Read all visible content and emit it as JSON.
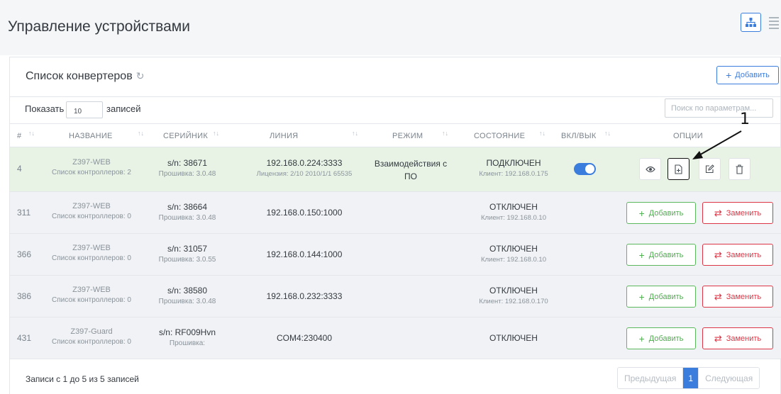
{
  "page": {
    "title": "Управление устройствами"
  },
  "card": {
    "title": "Список конвертеров",
    "add_button": "Добавить",
    "show_prefix": "Показать",
    "show_value": "10",
    "show_suffix": "записей",
    "search_placeholder": "Поиск по параметрам..."
  },
  "columns": [
    "#",
    "НАЗВАНИЕ",
    "СЕРИЙНИК",
    "ЛИНИЯ",
    "РЕЖИМ",
    "СОСТОЯНИЕ",
    "ВКЛ/ВЫК",
    "ОПЦИИ"
  ],
  "rows": [
    {
      "num": "4",
      "name": "Z397-WEB",
      "controllers": "Список контроллеров: 2",
      "serial": "s/n: 38671",
      "firmware": "Прошивка: 3.0.48",
      "line": "192.168.0.224:3333",
      "license": "Лицензия: 2/10 2010/1/1 65535",
      "mode": "Взаимодействия с ПО",
      "state": "ПОДКЛЮЧЕН",
      "client": "Клиент: 192.168.0.175",
      "enabled": true
    },
    {
      "num": "311",
      "name": "Z397-WEB",
      "controllers": "Список контроллеров: 0",
      "serial": "s/n: 38664",
      "firmware": "Прошивка: 3.0.48",
      "line": "192.168.0.150:1000",
      "license": "",
      "mode": "",
      "state": "ОТКЛЮЧЕН",
      "client": "Клиент: 192.168.0.10",
      "add": "Добавить",
      "replace": "Заменить"
    },
    {
      "num": "366",
      "name": "Z397-WEB",
      "controllers": "Список контроллеров: 0",
      "serial": "s/n: 31057",
      "firmware": "Прошивка: 3.0.55",
      "line": "192.168.0.144:1000",
      "license": "",
      "mode": "",
      "state": "ОТКЛЮЧЕН",
      "client": "Клиент: 192.168.0.10",
      "add": "Добавить",
      "replace": "Заменить"
    },
    {
      "num": "386",
      "name": "Z397-WEB",
      "controllers": "Список контроллеров: 0",
      "serial": "s/n: 38580",
      "firmware": "Прошивка: 3.0.48",
      "line": "192.168.0.232:3333",
      "license": "",
      "mode": "",
      "state": "ОТКЛЮЧЕН",
      "client": "Клиент: 192.168.0.170",
      "add": "Добавить",
      "replace": "Заменить"
    },
    {
      "num": "431",
      "name": "Z397-Guard",
      "controllers": "Список контроллеров: 0",
      "serial": "s/n: RF009Hvn",
      "firmware": "Прошивка:",
      "line": "COM4:230400",
      "license": "",
      "mode": "",
      "state": "ОТКЛЮЧЕН",
      "client": "",
      "add": "Добавить",
      "replace": "Заменить"
    }
  ],
  "footer": {
    "info": "Записи с 1 до 5 из 5 записей",
    "prev": "Предыдущая",
    "current": "1",
    "next": "Следующая"
  },
  "annotation": {
    "label": "1"
  },
  "colors": {
    "accent": "#3b7ddd",
    "success": "#5cb85c",
    "danger": "#dc3545",
    "active_row": "#e8f3e6",
    "row_bg": "#f0f2f5"
  }
}
